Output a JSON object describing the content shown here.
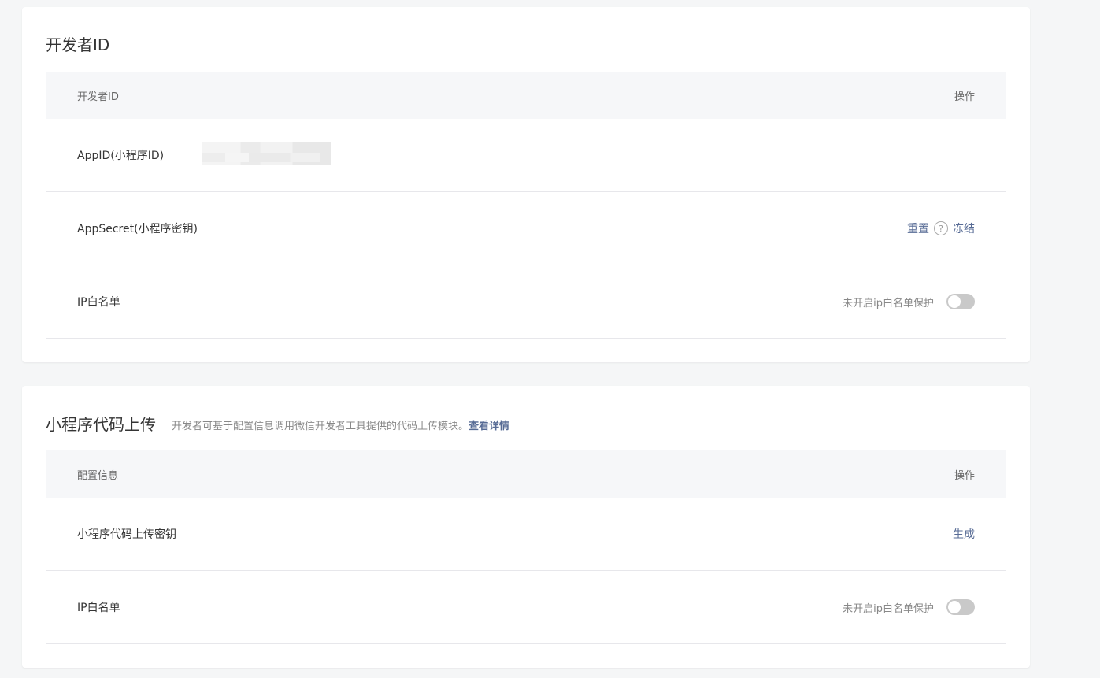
{
  "developer_id": {
    "title": "开发者ID",
    "table": {
      "header_left": "开发者ID",
      "header_right": "操作"
    },
    "rows": {
      "appid_label": "AppID(小程序ID)",
      "appsecret_label": "AppSecret(小程序密钥)",
      "reset_label": "重置",
      "help_icon": "?",
      "freeze_label": "冻结",
      "ip_label": "IP白名单",
      "ip_status": "未开启ip白名单保护"
    }
  },
  "code_upload": {
    "title": "小程序代码上传",
    "description": "开发者可基于配置信息调用微信开发者工具提供的代码上传模块。",
    "details_link": "查看详情",
    "table": {
      "header_left": "配置信息",
      "header_right": "操作"
    },
    "rows": {
      "upload_key_label": "小程序代码上传密钥",
      "generate_label": "生成",
      "ip_label": "IP白名单",
      "ip_status": "未开启ip白名单保护"
    }
  },
  "colors": {
    "link": "#576b95",
    "toggle_off": "#c9c9c9",
    "header_bg": "#f6f7f9"
  }
}
